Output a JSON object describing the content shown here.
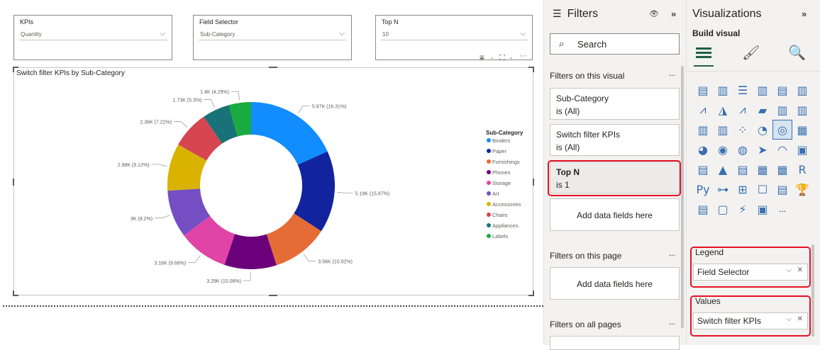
{
  "slicers": [
    {
      "title": "KPIs",
      "value": "Quantity"
    },
    {
      "title": "Field Selector",
      "value": "Sub-Category"
    },
    {
      "title": "Top N",
      "value": "10"
    }
  ],
  "visual_title": "Switch filter KPIs by Sub-Category",
  "chart_data": {
    "type": "pie",
    "donut": true,
    "title": "Switch filter KPIs by Sub-Category",
    "legend_title": "Sub-Category",
    "legend_position": "right",
    "categories": [
      "Binders",
      "Paper",
      "Furnishings",
      "Phones",
      "Storage",
      "Art",
      "Accessories",
      "Chairs",
      "Appliances",
      "Labels"
    ],
    "values": [
      5970,
      5180,
      3560,
      3290,
      3160,
      3000,
      2980,
      2360,
      1730,
      1400
    ],
    "labels": [
      "5.97K (16.31%)",
      "5.18K (15.87%)",
      "3.56K (10.92%)",
      "3.29K (10.08%)",
      "3.16K (9.68%)",
      "3K (9.2%)",
      "2.98K (9.12%)",
      "2.36K (7.22%)",
      "1.73K (5.3%)",
      "1.4K (4.29%)"
    ],
    "colors": [
      "#118dff",
      "#12239e",
      "#e66c37",
      "#6b007b",
      "#e044a7",
      "#744ec2",
      "#d9b300",
      "#d64550",
      "#197278",
      "#1aab40"
    ]
  },
  "filters": {
    "title": "Filters",
    "search_placeholder": "Search",
    "section_visual": "Filters on this visual",
    "cards": [
      {
        "name": "Sub-Category",
        "state": "is (All)"
      },
      {
        "name": "Switch filter KPIs",
        "state": "is (All)"
      },
      {
        "name": "Top N",
        "state": "is 1"
      }
    ],
    "add_label": "Add data fields here",
    "section_page": "Filters on this page",
    "add_label_page": "Add data fields here",
    "section_all": "Filters on all pages",
    "more": "..."
  },
  "visualizations": {
    "title": "Visualizations",
    "build_label": "Build visual",
    "more": "...",
    "wells": [
      {
        "label": "Legend",
        "field": "Field Selector"
      },
      {
        "label": "Values",
        "field": "Switch filter KPIs"
      }
    ]
  },
  "colors": {
    "accent": "#e81123",
    "pane": "#f3f2f1",
    "icon": "#3a6fb0"
  }
}
